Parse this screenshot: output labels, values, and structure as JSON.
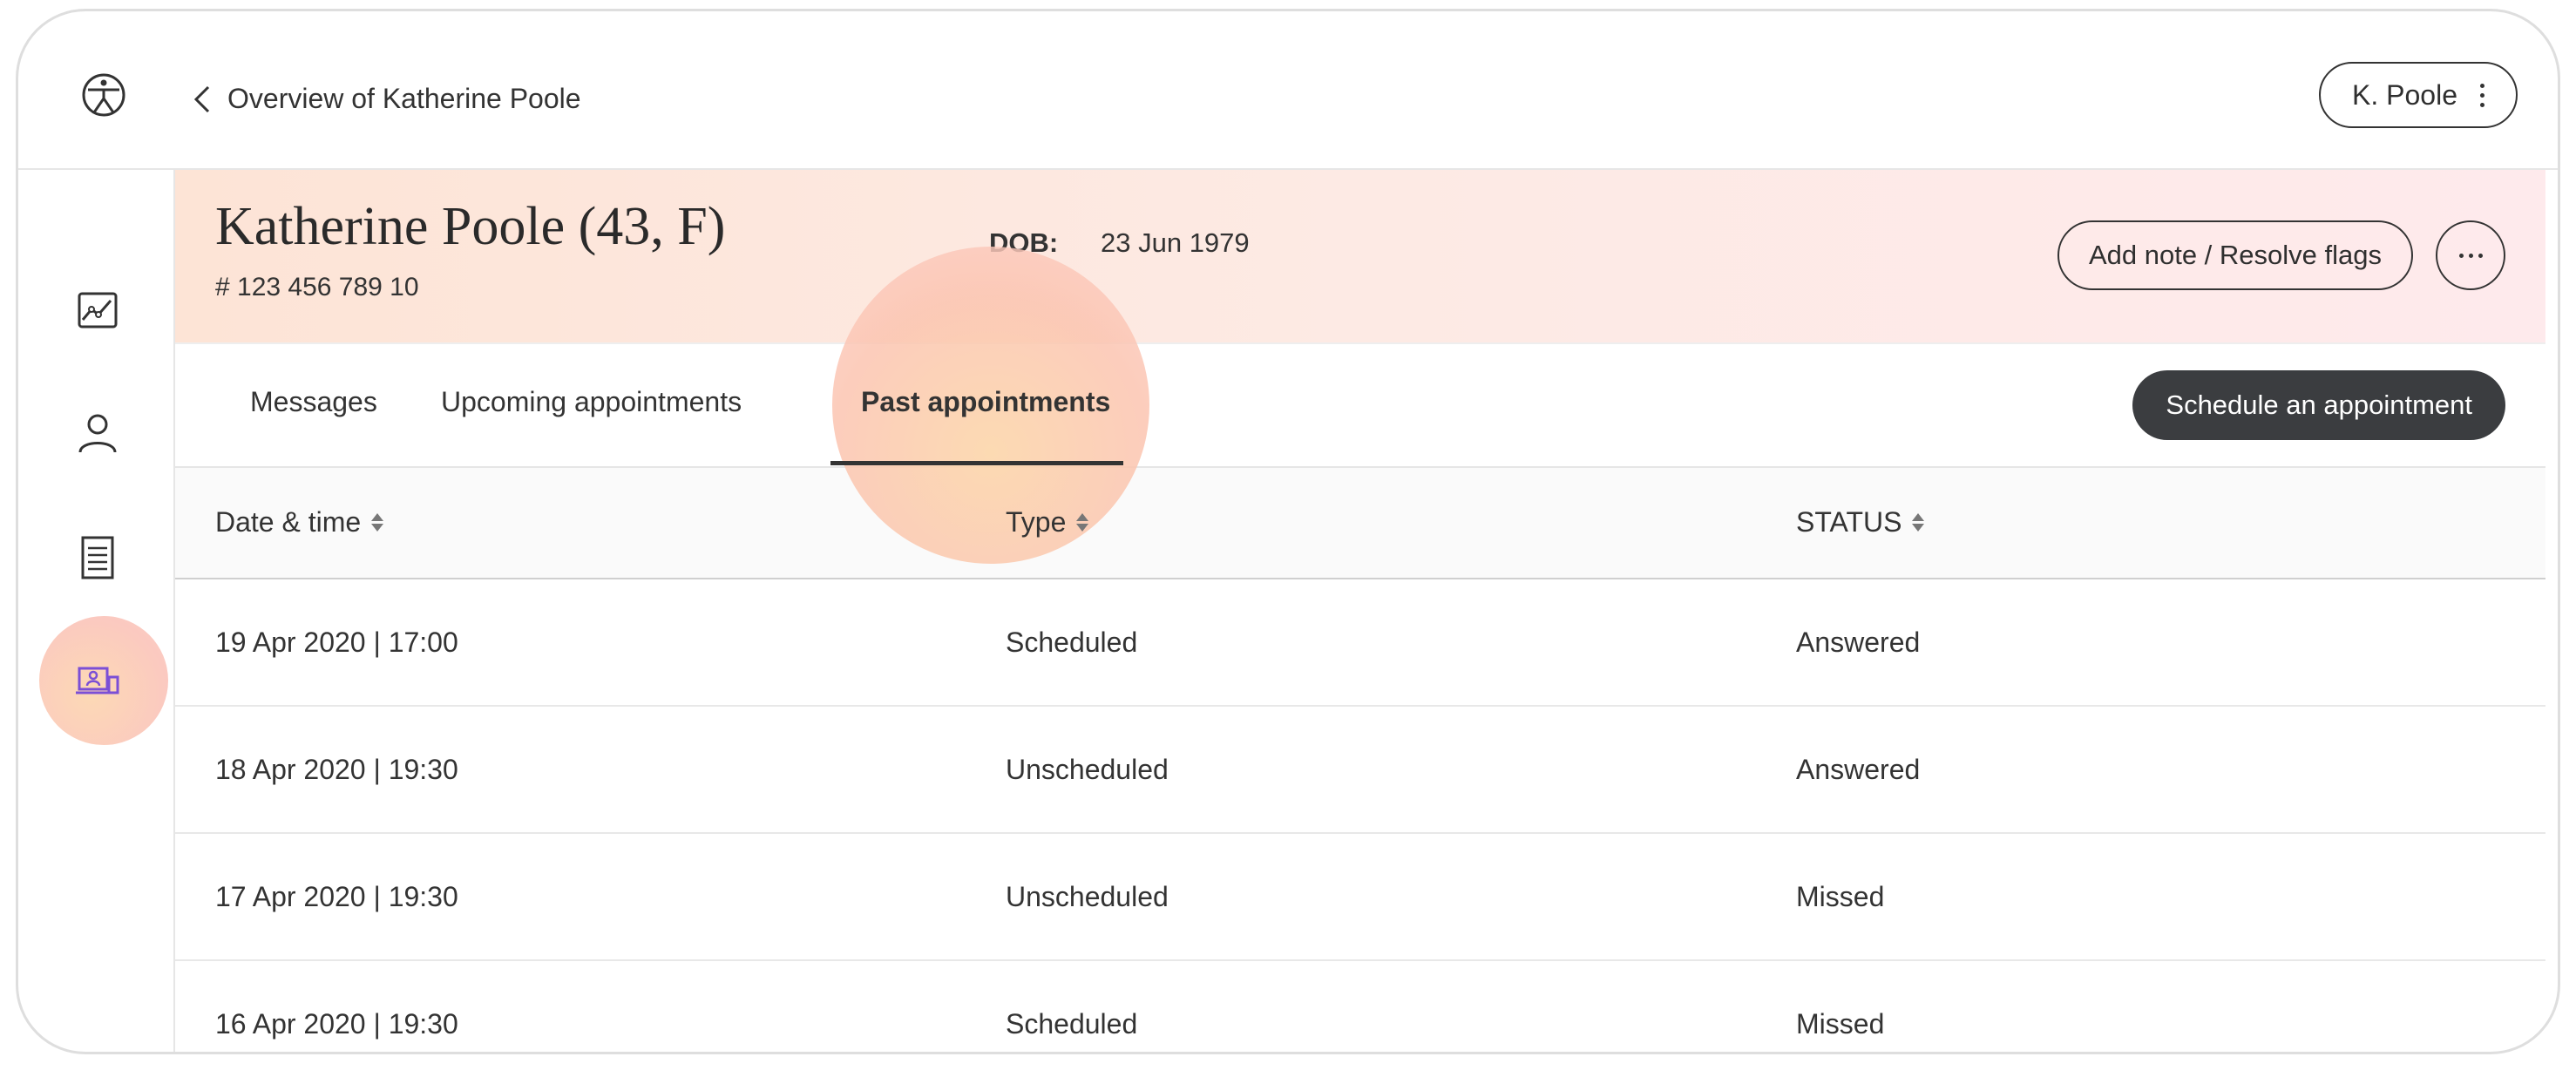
{
  "header": {
    "back_label": "Overview of Katherine Poole",
    "user_label": "K. Poole"
  },
  "sidebar": {
    "items": [
      {
        "icon": "chart-icon"
      },
      {
        "icon": "user-icon"
      },
      {
        "icon": "document-icon"
      },
      {
        "icon": "video-appointment-icon",
        "active": true
      }
    ]
  },
  "patient": {
    "name": "Katherine Poole (43, F)",
    "id": "# 123 456 789 10",
    "dob_label": "DOB:",
    "dob_value": "23 Jun 1979",
    "note_button": "Add note / Resolve flags"
  },
  "tabs": [
    {
      "label": "Messages"
    },
    {
      "label": "Upcoming appointments"
    },
    {
      "label": "Past appointments",
      "active": true
    }
  ],
  "schedule_button": "Schedule an appointment",
  "table": {
    "columns": [
      "Date & time",
      "Type",
      "STATUS"
    ],
    "rows": [
      [
        "19 Apr 2020 | 17:00",
        "Scheduled",
        "Answered"
      ],
      [
        "18 Apr 2020 | 19:30",
        "Unscheduled",
        "Answered"
      ],
      [
        "17 Apr 2020 | 19:30",
        "Unscheduled",
        "Missed"
      ],
      [
        "16 Apr 2020 | 19:30",
        "Scheduled",
        "Missed"
      ]
    ]
  },
  "colors": {
    "primary_dark": "#3b3d40",
    "active_icon": "#7b4fd6",
    "banner_start": "#fde4d6",
    "banner_end": "#feeaec"
  }
}
